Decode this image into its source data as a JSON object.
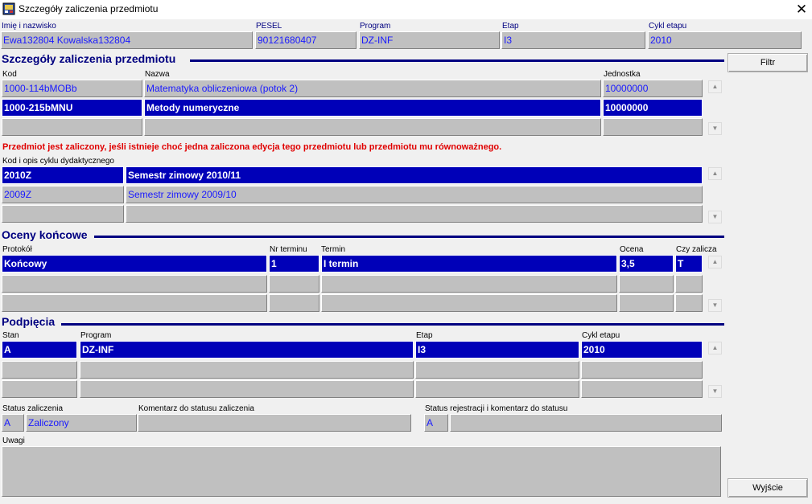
{
  "window": {
    "title": "Szczegóły zaliczenia przedmiotu",
    "close_glyph": "✕"
  },
  "student": {
    "name_label": "Imię i nazwisko",
    "name": "Ewa132804 Kowalska132804",
    "pesel_label": "PESEL",
    "pesel": "90121680407",
    "program_label": "Program",
    "program": "DZ-INF",
    "etap_label": "Etap",
    "etap": "I3",
    "cykl_label": "Cykl etapu",
    "cykl": "2010"
  },
  "subjects": {
    "title": "Szczegóły zaliczenia przedmiotu",
    "filter_button": "Filtr",
    "col_kod": "Kod",
    "col_nazwa": "Nazwa",
    "col_jednostka": "Jednostka",
    "rows": [
      {
        "kod": "1000-114bMOBb",
        "nazwa": "Matematyka obliczeniowa (potok 2)",
        "jednostka": "10000000"
      },
      {
        "kod": "1000-215bMNU",
        "nazwa": "Metody numeryczne",
        "jednostka": "10000000"
      }
    ],
    "warning": "Przedmiot jest zaliczony, jeśli istnieje choć jedna zaliczona edycja tego przedmiotu lub przedmiotu mu równoważnego."
  },
  "cycles": {
    "label": "Kod i opis cyklu dydaktycznego",
    "rows": [
      {
        "kod": "2010Z",
        "opis": "Semestr zimowy 2010/11"
      },
      {
        "kod": "2009Z",
        "opis": "Semestr zimowy 2009/10"
      }
    ]
  },
  "grades": {
    "title": "Oceny końcowe",
    "col_protokol": "Protokół",
    "col_nr": "Nr terminu",
    "col_termin": "Termin",
    "col_ocena": "Ocena",
    "col_czy": "Czy zalicza",
    "rows": [
      {
        "protokol": "Końcowy",
        "nr": "1",
        "termin": "I termin",
        "ocena": "3,5",
        "czy": "T"
      }
    ]
  },
  "links": {
    "title": "Podpięcia",
    "col_stan": "Stan",
    "col_program": "Program",
    "col_etap": "Etap",
    "col_cykl": "Cykl etapu",
    "rows": [
      {
        "stan": "A",
        "program": "DZ-INF",
        "etap": "I3",
        "cykl": "2010"
      }
    ]
  },
  "status": {
    "status_label": "Status zaliczenia",
    "status_code": "A",
    "status_text": "Zaliczony",
    "comment_label": "Komentarz do statusu zaliczenia",
    "reg_label": "Status rejestracji i komentarz do statusu",
    "reg_code": "A"
  },
  "notes": {
    "label": "Uwagi"
  },
  "exit_button": "Wyjście",
  "scroll": {
    "up": "▲",
    "down": "▼"
  }
}
